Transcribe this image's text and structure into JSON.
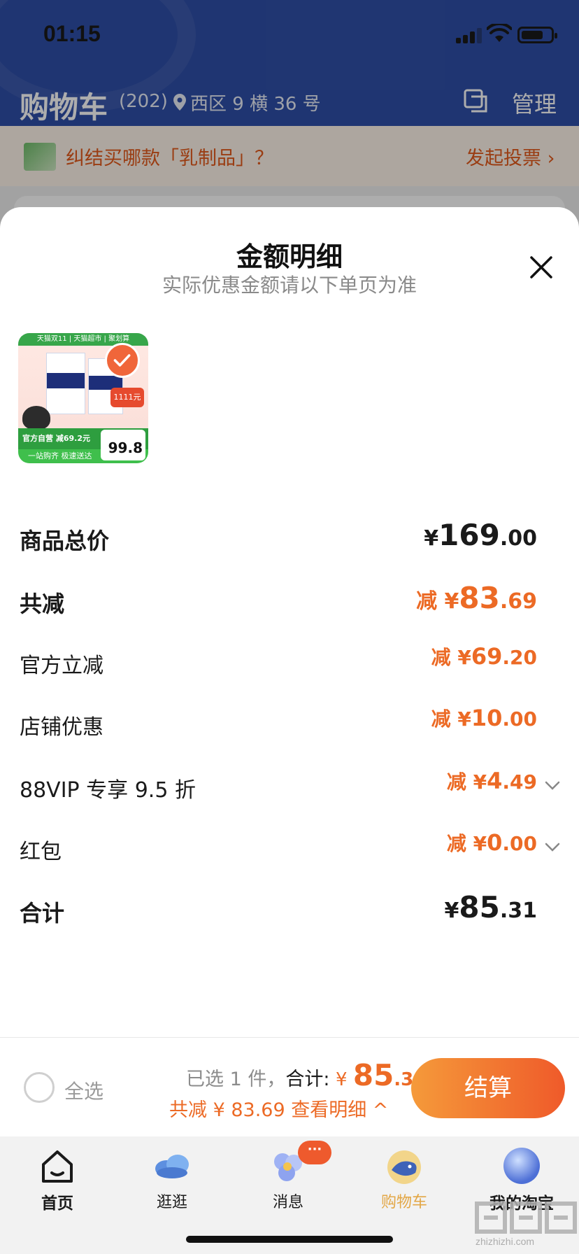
{
  "status_bar": {
    "time": "01:15"
  },
  "header": {
    "title": "购物车",
    "count": "(202)",
    "location": "西区 9 横 36 号",
    "location_chevron": "›",
    "manage_label": "管理"
  },
  "vote_bar": {
    "text": "纠结买哪款「乳制品」？",
    "action": "发起投票 ›"
  },
  "sheet": {
    "title": "金额明细",
    "subtitle": "实际优惠金额请以下单页为准",
    "product": {
      "top_band": "天猫双11 | 天猫超市 | 聚划算",
      "badge": "1111元",
      "tag": "官方自营 减69.2元",
      "bottom_band": "一站购齐 极速送达",
      "price": "99.8"
    },
    "rows": [
      {
        "label": "商品总价",
        "prefix": "",
        "yen": "¥",
        "int": "169",
        "dec": ".00"
      },
      {
        "label": "共减",
        "prefix": "减 ",
        "yen": "¥",
        "int": "83",
        "dec": ".69"
      },
      {
        "label": "官方立减",
        "prefix": "减 ",
        "yen": "¥",
        "int": "69",
        "dec": ".20"
      },
      {
        "label": "店铺优惠",
        "prefix": "减 ",
        "yen": "¥",
        "int": "10",
        "dec": ".00"
      },
      {
        "label": "88VIP 专享 9.5 折",
        "prefix": "减 ",
        "yen": "¥",
        "int": "4",
        "dec": ".49"
      },
      {
        "label": "红包",
        "prefix": "减 ",
        "yen": "¥",
        "int": "0",
        "dec": ".00"
      },
      {
        "label": "合计",
        "prefix": "",
        "yen": "¥",
        "int": "85",
        "dec": ".31"
      }
    ]
  },
  "checkout": {
    "select_all": "全选",
    "selected": "已选 1 件，",
    "sum_label": "合计: ",
    "yen": "¥ ",
    "amount_int": "85",
    "amount_dec": ".31",
    "reduction_text": "共减 ¥ 83.69  查看明细 ^",
    "pay_label": "结算"
  },
  "tabbar": {
    "tabs": [
      {
        "label": "首页"
      },
      {
        "label": "逛逛"
      },
      {
        "label": "消息"
      },
      {
        "label": "购物车"
      },
      {
        "label": "我的淘宝"
      }
    ],
    "message_badge": "···"
  },
  "watermark": {
    "text": "zhizhizhi.com"
  },
  "colors": {
    "header": "#2f4fa8",
    "accent": "#ec6a25",
    "active_tab": "#e3a746"
  }
}
